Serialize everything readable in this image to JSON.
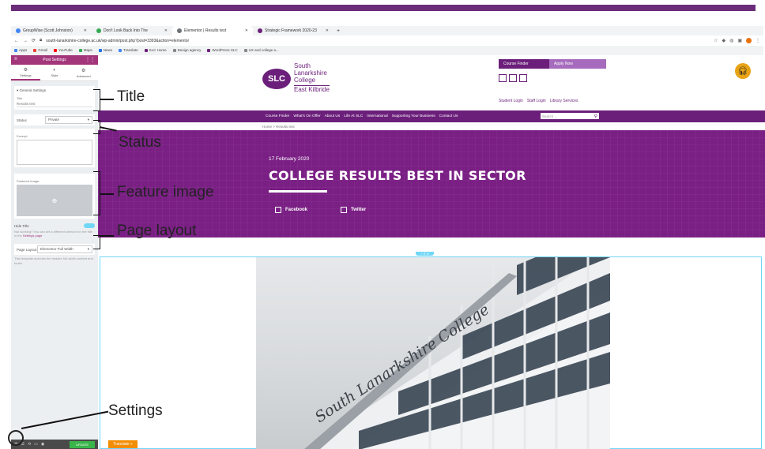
{
  "browser": {
    "tabs": [
      {
        "label": "GroupWise (Scott Johnston)",
        "color": "#4285f4"
      },
      {
        "label": "Don't Look Back Into The",
        "color": "#34a853"
      },
      {
        "label": "Elementor | Results test",
        "color": "#6e7277"
      },
      {
        "label": "Strategic Framework 2020-23",
        "color": "#6b1f7a"
      }
    ],
    "url": "south-lanarkshire-college.ac.uk/wp-admin/post.php?post=3393&action=elementor",
    "bookmarks": [
      "Apps",
      "Gmail",
      "YouTube",
      "Maps",
      "News",
      "Translate",
      "SLC Home",
      "Design agency",
      "WordPress SLC",
      "UX and college a..."
    ]
  },
  "panel": {
    "header": "Post Settings",
    "tabs": [
      "Settings",
      "Style",
      "Advanced"
    ],
    "section_title": "General Settings",
    "title_label": "Title",
    "title_value": "Results test",
    "status_label": "Status",
    "status_value": "Private",
    "excerpt_label": "Excerpt",
    "featured_label": "Featured Image",
    "hide_title_label": "Hide Title",
    "hide_title_note": "Not working? You can set a different selector for the title in the",
    "settings_link": "Settings page",
    "page_layout_label": "Page Layout",
    "page_layout_value": "Elementor Full Width",
    "page_layout_note": "This template includes the header, full-width content and footer",
    "update_label": "UPDATE"
  },
  "site": {
    "logo_initials": "SLC",
    "logo_line1": "South",
    "logo_line2": "Lanarkshire",
    "logo_line3": "College",
    "logo_campus": "East Kilbride",
    "course_finder": "Course Finder",
    "apply_now": "Apply Now",
    "logins": [
      "Student Login",
      "Staff Login",
      "Library Services"
    ],
    "nav": [
      "Course Finder",
      "What's On Offer",
      "About Us",
      "Life At SLC",
      "International",
      "Supporting Your Business",
      "Contact Us"
    ],
    "search_placeholder": "Search ...",
    "breadcrumb": "Home > Results test",
    "date": "17 February 2020",
    "headline": "COLLEGE RESULTS BEST IN SECTOR",
    "share": [
      "Facebook",
      "Twitter"
    ],
    "building_sign": "South Lanarkshire College",
    "translate": "Translate »"
  },
  "annotations": {
    "title": "Title",
    "status": "Status",
    "feature_image": "Feature image",
    "page_layout": "Page layout",
    "settings": "Settings"
  }
}
